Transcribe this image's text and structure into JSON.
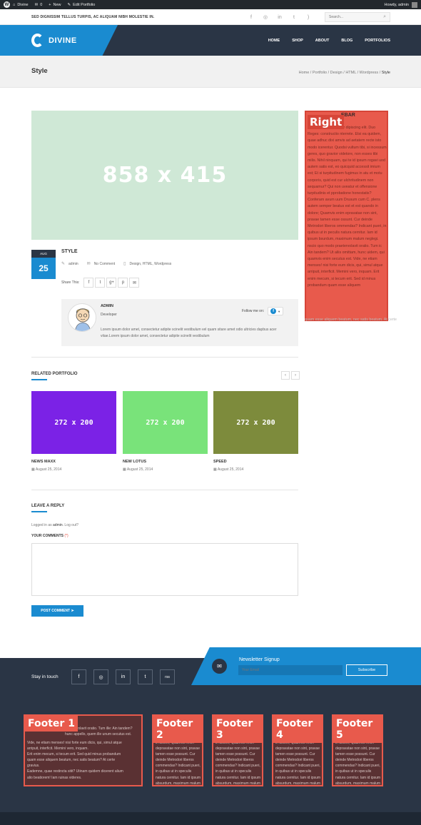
{
  "admin_bar": {
    "site_name": "Divine",
    "comments_count": "0",
    "new_label": "New",
    "edit_label": "Edit Portfolio",
    "greeting": "Howdy, admin"
  },
  "top_bar": {
    "tagline": "SED DIGNISSIM TELLUS TURPIS, AC ALIQUAM NIBH MOLESTIE IN.",
    "search_placeholder": "Search..."
  },
  "header": {
    "logo_text": "DIVINE",
    "nav": [
      "HOME",
      "SHOP",
      "ABOUT",
      "BLOG",
      "PORTFOLIOS"
    ]
  },
  "page_title": {
    "title": "Style",
    "breadcrumbs": "Home / Portfolio / Design / HTML / Wordpress / ",
    "current": "Style"
  },
  "post": {
    "featured_label": "858 x 415",
    "month": "AUG",
    "day": "25",
    "title": "STYLE",
    "author": "admin",
    "comments": "No Comment",
    "categories": "Design, HTML, Wordpress",
    "share_label": "Share This:"
  },
  "author_box": {
    "name": "ADMIN",
    "role": "Developer",
    "follow_label": "Follow me on:",
    "bio": "Lorem ipsum dolor amet, consectetur adipite scinelit vestibulum vel quam sitare amet odio ultricies dapbus acer vitae.Lorem ipsum dolor amet, consectetur adipite scinelit vestibulum"
  },
  "related": {
    "title": "RELATED PORTFOLIO",
    "items": [
      {
        "thumb": "272 x 200",
        "title": "NEWS MAXX",
        "date": "August 25, 2014",
        "color": "#7b22e6"
      },
      {
        "thumb": "272 x 200",
        "title": "NEW LOTUS",
        "date": "August 25, 2014",
        "color": "#79e37a"
      },
      {
        "thumb": "272 x 200",
        "title": "SPEED",
        "date": "August 25, 2014",
        "color": "#7d8b3c"
      }
    ]
  },
  "reply": {
    "title": "LEAVE A REPLY",
    "logged_prefix": "Logged in as ",
    "logged_user": "admin",
    "logged_suffix": ". Log out?",
    "comments_label": "YOUR COMMENTS",
    "required": "(*)",
    "button": "POST COMMENT"
  },
  "sidebar": {
    "overlay_label": "Right",
    "heading": "EBAR",
    "text": "r sit amet, consectetur dipiscing elit. Duo Reges: constructio nterrete. Etsi ea quidem, quae adhuc dixi amvis ad aetatem recte isto modo icerentur. Quodsi vultum tibi, si incessum geres, quo gravior videtore, non esses tibi milis. Nihil ninquam, qui te id ipsum rogavi uod autem satis est, eo quicquid accessit imium est; Et si turpitudinem fugimus in atu et motu corporis, quid est cur ulchritudinem non sequamur? Qui non uveatur et offensione turpitudinis et pprobatione honestatis? Conferam avum uum Drusum cum C. plens autem semper beatus est et est quando in dolore; Quamvis enim epravatae non sint, pravae tamen esse ossunt. Cur deinde Metrodori liberos ommendas? Indicant pueri, in quibus ut in peculis natura cernitur. Iam id ipsum bsurdum, maximum malum neglegi. nscio quo modo praetervolavit oratio. Tum ic Ain tandem? Ut aliis omittam, hunc uidem, qui quamvis enim secutus est. Vide, ne etiam menses! nisi forte eum dicis, qui, simul atque arripuit, interficit. Memini vero, inquam. Erit enim mecum, si tecum erit. Sed id minus probandum quam esse aliquem"
  },
  "sidebar_tail": "quam esse aliquem beatum, nec satis beatum. At certe",
  "footer_band": {
    "stay_label": "Stay in touch",
    "social": [
      "f",
      "◎",
      "in",
      "t",
      "rss"
    ],
    "newsletter_title": "Newsletter Signup",
    "email_placeholder": "Your Email",
    "subscribe": "Subscribe"
  },
  "footer_widgets": [
    {
      "label": "Footer 1",
      "top_text": "praetervolavit oratio. Tum ille: Ain tandem?\nhunc appello, quem ille unum secutus est.",
      "text": "Vide, ne etiam menses! nisi forte eum dicis, qui, simul atque\narripuit, interficit. Memini vero, inquam.\nErit enim mecum, si tecum erit. Sed quid minus probandum\nquam esse aliquem beatum, nec satis beatum? At certe\ngravius.\nEademne, quae restincta sitit? Utinam quidem dicerent alium\nalio beatiorem! Iam ruinas videres."
    },
    {
      "label": "Footer 2",
      "top_text": "",
      "text": "in dolore; Quamvis enim\ndepravatae non sint, pravae\ntamen esse possunt. Cur\ndeinde Metrodori liberos\ncommendas? Indicant pueri,\nin quibus ut in speculis\nnatura cernitur. Iam id ipsum\nabsurdum, maximum malum\nneglegi."
    },
    {
      "label": "Footer 3",
      "top_text": "",
      "text": "in dolore; Quamvis enim\ndepravatae non sint, pravae\ntamen esse possunt. Cur\ndeinde Metrodori liberos\ncommendas? Indicant pueri,\nin quibus ut in speculis\nnatura cernitur. Iam id ipsum\nabsurdum, maximum malum\nneglegi."
    },
    {
      "label": "Footer 4",
      "top_text": "",
      "text": "in dolore; Quamvis enim\ndepravatae non sint, pravae\ntamen esse possunt. Cur\ndeinde Metrodori liberos\ncommendas? Indicant pueri,\nin quibus ut in speculis\nnatura cernitur. Iam id ipsum\nabsurdum, maximum malum\nneglegi."
    },
    {
      "label": "Footer 5",
      "top_text": "",
      "text": "in dolore; Quamvis enim\ndepravatae non sint, pravae\ntamen esse possunt. Cur\ndeinde Metrodori liberos\ncommendas? Indicant pueri,\nin quibus ut in speculis\nnatura cernitur. Iam id ipsum\nabsurdum, maximum malum\nneglegi."
    }
  ]
}
